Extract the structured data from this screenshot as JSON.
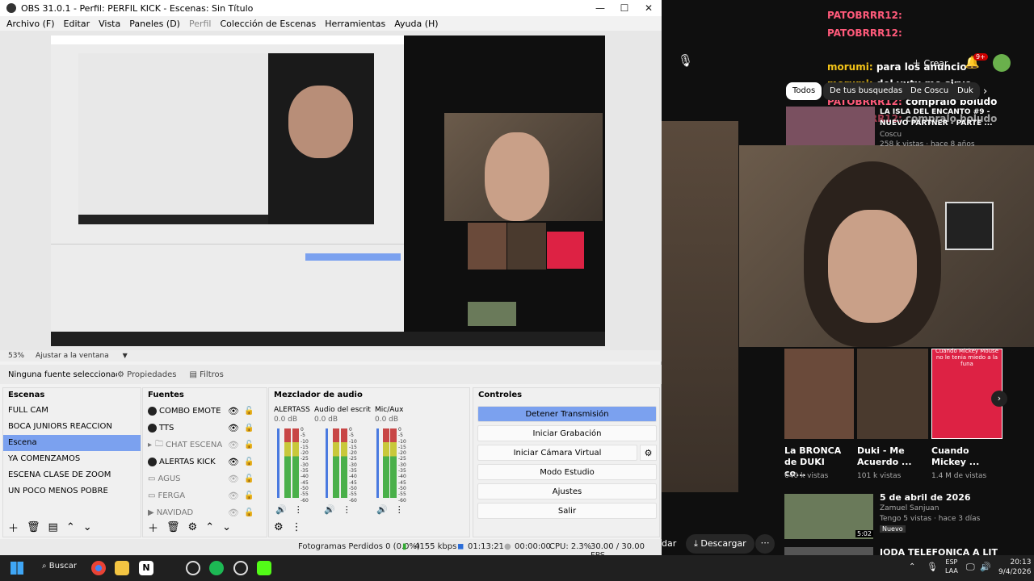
{
  "window": {
    "title": "OBS 31.0.1 - Perfil: PERFIL KICK - Escenas: Sin Título",
    "minimize": "—",
    "maximize": "☐",
    "close": "✕"
  },
  "menu": [
    "Archivo (F)",
    "Editar",
    "Vista",
    "Paneles (D)",
    "Perfil",
    "Colección de Escenas",
    "Herramientas",
    "Ayuda (H)"
  ],
  "zoom": {
    "level": "53%",
    "mode": "Ajustar a la ventana"
  },
  "source_bar": {
    "none": "Ninguna fuente seleccionada",
    "properties": "Propiedades",
    "filters": "Filtros"
  },
  "scenes": {
    "title": "Escenas",
    "items": [
      "FULL CAM",
      "BOCA JUNIORS REACCION",
      "Escena",
      "YA COMENZAMOS",
      "ESCENA CLASE DE ZOOM",
      "UN POCO MENOS POBRE"
    ],
    "selected": 2
  },
  "sources": {
    "title": "Fuentes",
    "items": [
      "COMBO EMOTE",
      "TTS",
      "CHAT ESCENA",
      "ALERTAS KICK",
      "AGUS",
      "FERGA",
      "NAVIDAD"
    ]
  },
  "mixer": {
    "title": "Mezclador de audio",
    "channels": [
      {
        "name": "ALERTASS",
        "db": "0.0 dB"
      },
      {
        "name": "Audio del escrito",
        "db": "0.0 dB"
      },
      {
        "name": "Mic/Aux",
        "db": "0.0 dB"
      }
    ],
    "scale": [
      "0",
      "-5",
      "-10",
      "-15",
      "-20",
      "-25",
      "-30",
      "-35",
      "-40",
      "-45",
      "-50",
      "-55",
      "-60"
    ]
  },
  "controls": {
    "title": "Controles",
    "stop_stream": "Detener Transmisión",
    "start_record": "Iniciar Grabación",
    "virtual_cam": "Iniciar Cámara Virtual",
    "studio_mode": "Modo Estudio",
    "settings": "Ajustes",
    "exit": "Salir"
  },
  "status": {
    "dropped": "Fotogramas Perdidos 0 (0.0%)",
    "bitrate": "4155 kbps",
    "stream_time": "01:13:21",
    "record_time": "00:00:00",
    "cpu": "CPU: 2.3%",
    "fps": "30.00 / 30.00 FPS"
  },
  "chat": [
    {
      "user": "PATOBRRR12:",
      "msg": ""
    },
    {
      "user": "PATOBRRR12:",
      "msg": ""
    },
    {
      "user": "morumi:",
      "msg": "para los anuncio"
    },
    {
      "user": "morumi:",
      "msg": "del yutu me sirve"
    },
    {
      "user": "PATOBRRR12:",
      "msg": "compralo boludo"
    },
    {
      "user": "PATOBRRR12:",
      "msg": "compralo boludo"
    }
  ],
  "youtube": {
    "create": "Crear",
    "notif_count": "9+",
    "chips": [
      "Todos",
      "De tus busquedas",
      "De Coscu",
      "Duk"
    ],
    "top_video": {
      "title": "LA ISLA DEL ENCANTO #9 - NUEVO PARTNER - PARTE ...",
      "channel": "Coscu",
      "meta": "258 k vistas · hace 8 años"
    },
    "shorts": [
      {
        "title": "La BRONCA de DUKI co...",
        "views": "640 k vistas"
      },
      {
        "title": "Duki - Me Acuerdo ...",
        "views": "101 k vistas"
      },
      {
        "title": "Cuando Mickey ...",
        "views": "1.4 M de vistas"
      }
    ],
    "short_caption": "Cuando Mickey Mouse no le tenia miedo a la funa",
    "video2": {
      "title": "5 de abril de 2026",
      "channel": "Zamuel Sanjuan",
      "meta": "Tengo 5 vistas · hace 3 días",
      "badge": "Nuevo",
      "duration": "5:02"
    },
    "video3": {
      "title": "JODA TELEFONICA A LIT"
    },
    "download": "Descargar",
    "share_partial": "dar"
  },
  "taskbar": {
    "search": "Buscar",
    "lang": "ESP",
    "lang2": "LAA",
    "time": "20:13",
    "date": "9/4/2026"
  }
}
